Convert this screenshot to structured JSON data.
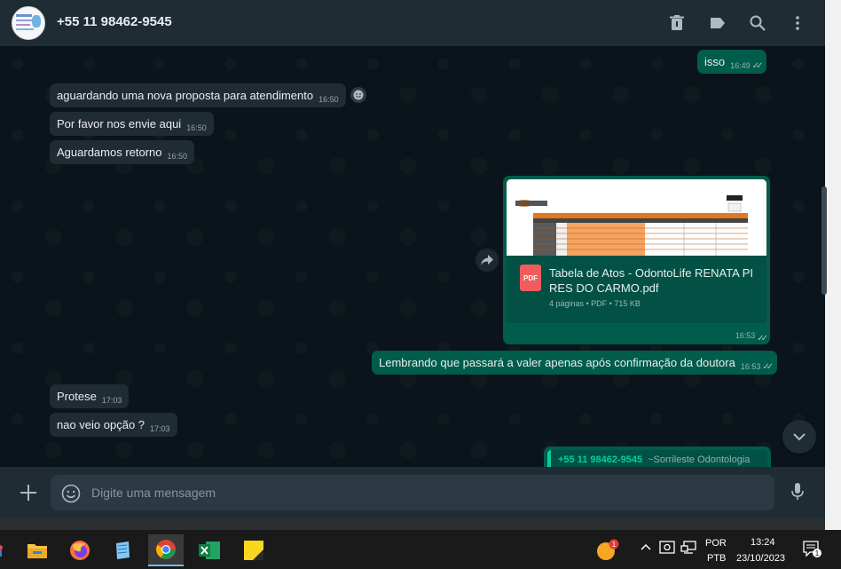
{
  "header": {
    "contact_name": "+55 11 98462-9545",
    "icons": [
      "delete-icon",
      "label-icon",
      "search-icon",
      "menu-icon"
    ]
  },
  "messages": [
    {
      "direction": "out",
      "text": "isso",
      "time": "16:49",
      "status": "read"
    },
    {
      "direction": "in",
      "text": "aguardando uma nova proposta para atendimento",
      "time": "16:50"
    },
    {
      "direction": "in",
      "text": "Por favor nos envie aqui",
      "time": "16:50"
    },
    {
      "direction": "in",
      "text": "Aguardamos retorno",
      "time": "16:50"
    },
    {
      "direction": "out",
      "type": "document",
      "file_name": "Tabela de Atos - OdontoLife RENATA PIRES DO CARMO.pdf",
      "file_type": "PDF",
      "meta": "4 páginas • PDF • 715 KB",
      "time": "16:53",
      "status": "read"
    },
    {
      "direction": "out",
      "text": "Lembrando que passará a valer apenas após confirmação da doutora",
      "time": "16:53",
      "status": "read"
    },
    {
      "direction": "in",
      "text": "Protese",
      "time": "17:03"
    },
    {
      "direction": "in",
      "text": "nao veio opção ?",
      "time": "17:03"
    }
  ],
  "quoted_reply": {
    "phone": "+55 11 98462-9545",
    "alias": "~Sorrileste Odontologia"
  },
  "composer": {
    "placeholder": "Digite uma mensagem"
  },
  "taskbar": {
    "apps": [
      "file-explorer",
      "firefox",
      "notepad",
      "chrome",
      "excel",
      "sticky-notes"
    ],
    "active_app": "chrome",
    "language": "POR",
    "layout": "PTB",
    "time": "13:24",
    "date": "23/10/2023",
    "notification_count": "1",
    "tray_badge": "1"
  },
  "colors": {
    "outgoing": "#005c4b",
    "incoming": "#202c33",
    "background": "#0b141a",
    "accent": "#06cf9c"
  }
}
